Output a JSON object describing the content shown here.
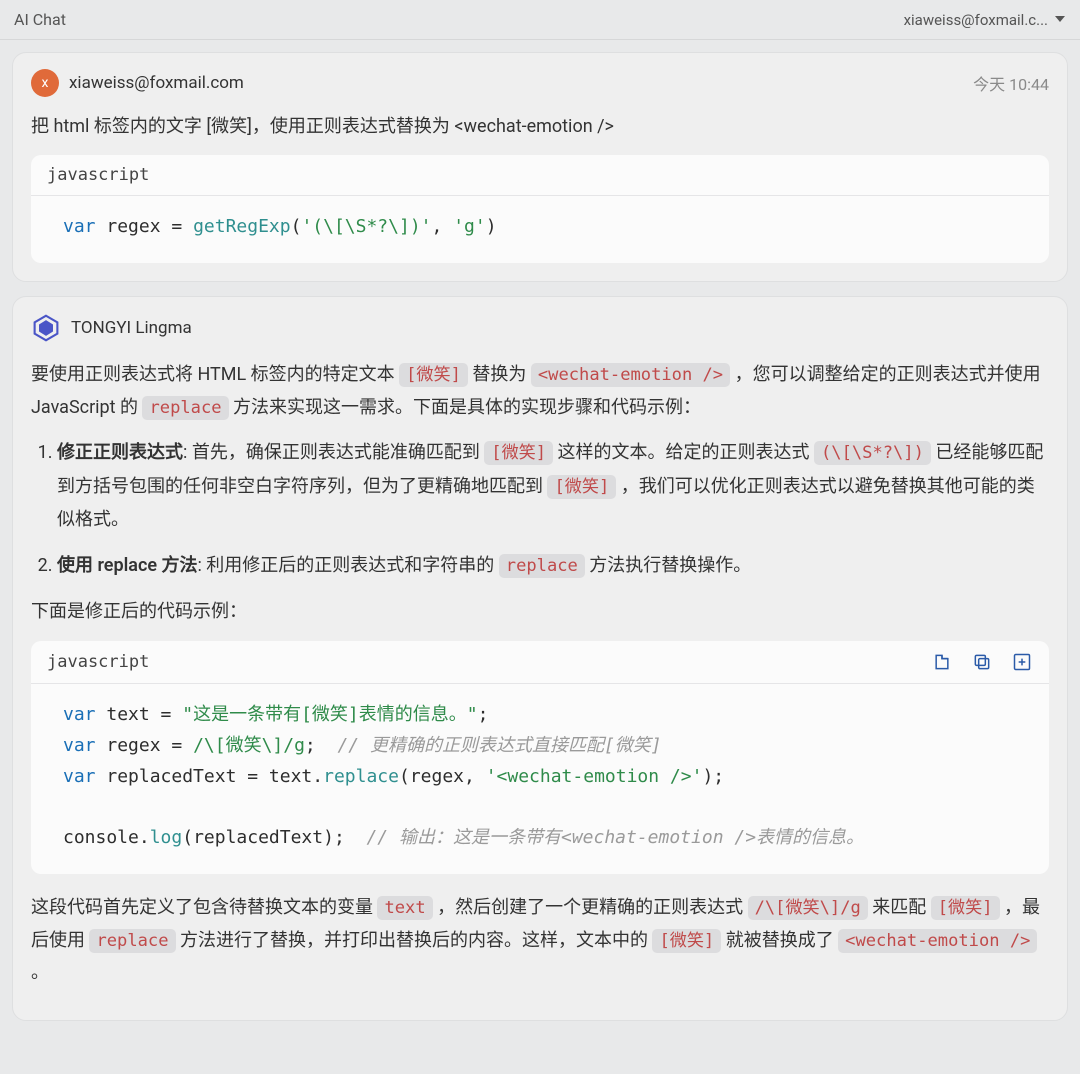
{
  "titlebar": {
    "title": "AI Chat",
    "account": "xiaweiss@foxmail.c..."
  },
  "user_msg": {
    "avatar_letter": "x",
    "sender": "xiaweiss@foxmail.com",
    "timestamp": "今天 10:44",
    "text_1": "把 html 标签内的文字 [微笑]，使用正则表达式替换为 <wechat-emotion />",
    "code_lang": "javascript",
    "code": {
      "kw_var": "var",
      "v_regex": "regex",
      "eq": " = ",
      "fn": "getRegExp",
      "lp": "(",
      "s1": "'(\\[\\S*?\\])'",
      "comma": ", ",
      "s2": "'g'",
      "rp": ")"
    }
  },
  "ai_msg": {
    "sender": "TONGYI Lingma",
    "intro": {
      "t1": "要使用正则表达式将 HTML 标签内的特定文本 ",
      "c1": "[微笑]",
      "t2": " 替换为 ",
      "c2": "<wechat-emotion />",
      "t3": " ，您可以调整给定的正则表达式并使用 JavaScript 的 ",
      "c3": "replace",
      "t4": " 方法来实现这一需求。下面是具体的实现步骤和代码示例："
    },
    "step1": {
      "title": "修正正则表达式",
      "t1": ": 首先，确保正则表达式能准确匹配到 ",
      "c1": "[微笑]",
      "t2": " 这样的文本。给定的正则表达式 ",
      "c2": "(\\[\\S*?\\])",
      "t3": " 已经能够匹配到方括号包围的任何非空白字符序列，但为了更精确地匹配到 ",
      "c3": "[微笑]",
      "t4": " ，我们可以优化正则表达式以避免替换其他可能的类似格式。"
    },
    "step2": {
      "title": "使用 replace 方法",
      "t1": ": 利用修正后的正则表达式和字符串的 ",
      "c1": "replace",
      "t2": " 方法执行替换操作。"
    },
    "below": "下面是修正后的代码示例：",
    "code_lang": "javascript",
    "code2": {
      "l1": {
        "kw": "var",
        "v": "text",
        "eq": " = ",
        "s": "\"这是一条带有[微笑]表情的信息。\"",
        "semi": ";"
      },
      "l2": {
        "kw": "var",
        "v": "regex",
        "eq": " = ",
        "r": "/\\[微笑\\]/g",
        "semi": ";  ",
        "cmt": "// 更精确的正则表达式直接匹配[微笑]"
      },
      "l3": {
        "kw": "var",
        "v": "replacedText",
        "eq": " = ",
        "obj": "text",
        "dot": ".",
        "fn": "replace",
        "lp": "(",
        "a1": "regex",
        "comma": ", ",
        "s": "'<wechat-emotion />'",
        "rp": ")",
        "semi": ";"
      },
      "blank": "",
      "l5": {
        "obj": "console",
        "dot": ".",
        "fn": "log",
        "lp": "(",
        "a1": "replacedText",
        "rp": ")",
        "semi": ";  ",
        "cmt": "// 输出：这是一条带有<wechat-emotion />表情的信息。"
      }
    },
    "outro": {
      "t1": "这段代码首先定义了包含待替换文本的变量 ",
      "c1": "text",
      "t2": " ，然后创建了一个更精确的正则表达式 ",
      "c2": "/\\[微笑\\]/g",
      "t3": " 来匹配 ",
      "c3": "[微笑]",
      "t4": " ，最后使用 ",
      "c4": "replace",
      "t5": " 方法进行了替换，并打印出替换后的内容。这样，文本中的 ",
      "c5": "[微笑]",
      "t6": " 就被替换成了 ",
      "c6": "<wechat-emotion />",
      "t7": " 。"
    }
  }
}
